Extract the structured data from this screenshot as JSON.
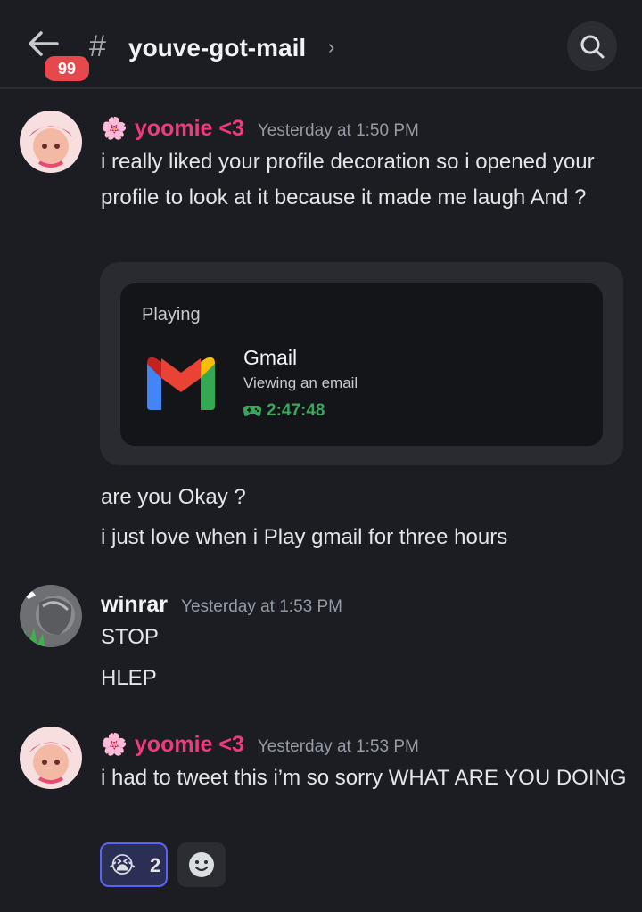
{
  "header": {
    "back_icon": "arrow-left-icon",
    "badge": "99",
    "hash": "#",
    "channel": "youve-got-mail",
    "chevron": "›",
    "search_icon": "search-icon"
  },
  "messages": [
    {
      "author": "yoomie <3",
      "author_emoji": "🌸",
      "timestamp": "Yesterday at 1:50 PM",
      "lines": [
        "i really liked your profile decoration so i opened your profile to look at it because it made me laugh And  ?"
      ],
      "embed": {
        "heading": "Playing",
        "app_name": "Gmail",
        "detail": "Viewing an email",
        "elapsed": "2:47:48"
      },
      "followups": [
        "are you Okay ?",
        "i just love when i Play gmail for three hours"
      ]
    },
    {
      "author": "winrar",
      "timestamp": "Yesterday at 1:53 PM",
      "lines": [
        "STOP",
        "HLEP"
      ]
    },
    {
      "author": "yoomie <3",
      "author_emoji": "🌸",
      "timestamp": "Yesterday at 1:53 PM",
      "lines": [
        "i had to tweet this i’m so sorry WHAT ARE YOU DOING"
      ],
      "reactions": [
        {
          "emoji": "😭",
          "count": "2"
        }
      ]
    }
  ],
  "colors": {
    "background": "#1c1d22",
    "pink_name": "#f0397f",
    "accent": "#5865f2",
    "badge": "#e5484d",
    "playtime": "#3ba55d"
  }
}
